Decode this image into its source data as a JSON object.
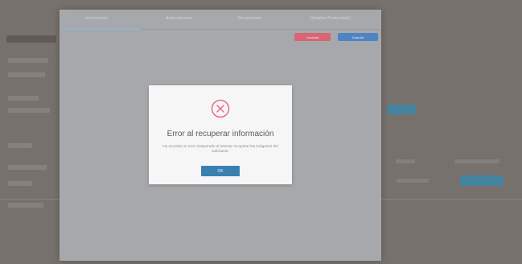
{
  "tabs": [
    "Información",
    "Antecedentes",
    "Documentos",
    "Detalles Protocolo(s)"
  ],
  "actions": {
    "left_button": "Cancelar",
    "right_button": "Guardar"
  },
  "dialog": {
    "title": "Error al recuperar información",
    "message": "Ha ocurrido un error inesperado al intentar recuperar las imágenes del solicitante.",
    "ok_label": "OK"
  },
  "colors": {
    "error_red": "#e96b86",
    "primary_blue": "#3b7fb0",
    "cancel_red": "#d86476",
    "save_blue": "#4e84c4"
  }
}
